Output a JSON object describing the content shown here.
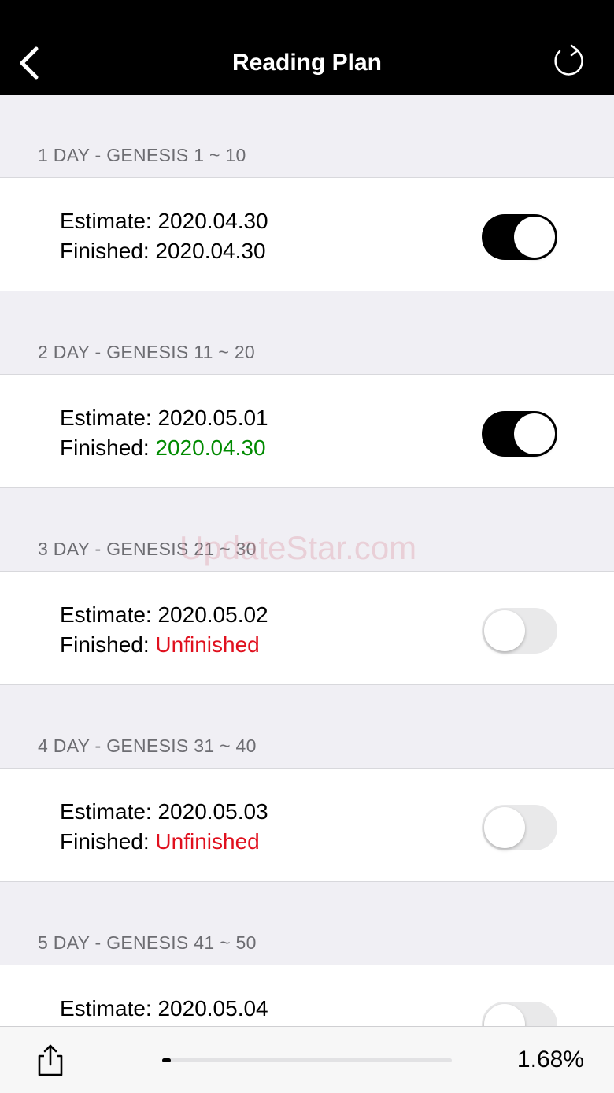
{
  "navbar": {
    "title": "Reading Plan",
    "back_icon": "chevron-left-icon",
    "refresh_icon": "refresh-icon"
  },
  "watermark": "UpdateStar.com",
  "colors": {
    "finished_on_time": "#008a00",
    "unfinished": "#e0101e",
    "toggle_on": "#000000",
    "toggle_off": "#e9e9ea"
  },
  "sections": [
    {
      "header": "1 DAY - GENESIS 1 ~ 10",
      "estimate_label": "Estimate:",
      "estimate_value": "2020.04.30",
      "finished_label": "Finished:",
      "finished_value": "2020.04.30",
      "finished_status": "normal",
      "toggle_on": true
    },
    {
      "header": "2 DAY - GENESIS 11 ~ 20",
      "estimate_label": "Estimate:",
      "estimate_value": "2020.05.01",
      "finished_label": "Finished:",
      "finished_value": "2020.04.30",
      "finished_status": "early",
      "toggle_on": true
    },
    {
      "header": "3 DAY - GENESIS 21 ~ 30",
      "estimate_label": "Estimate:",
      "estimate_value": "2020.05.02",
      "finished_label": "Finished:",
      "finished_value": "Unfinished",
      "finished_status": "unfinished",
      "toggle_on": false
    },
    {
      "header": "4 DAY - GENESIS 31 ~ 40",
      "estimate_label": "Estimate:",
      "estimate_value": "2020.05.03",
      "finished_label": "Finished:",
      "finished_value": "Unfinished",
      "finished_status": "unfinished",
      "toggle_on": false
    },
    {
      "header": "5 DAY - GENESIS 41 ~ 50",
      "estimate_label": "Estimate:",
      "estimate_value": "2020.05.04",
      "toggle_on": false
    }
  ],
  "bottombar": {
    "share_icon": "share-icon",
    "progress_percent": 1.68,
    "progress_label": "1.68%"
  }
}
